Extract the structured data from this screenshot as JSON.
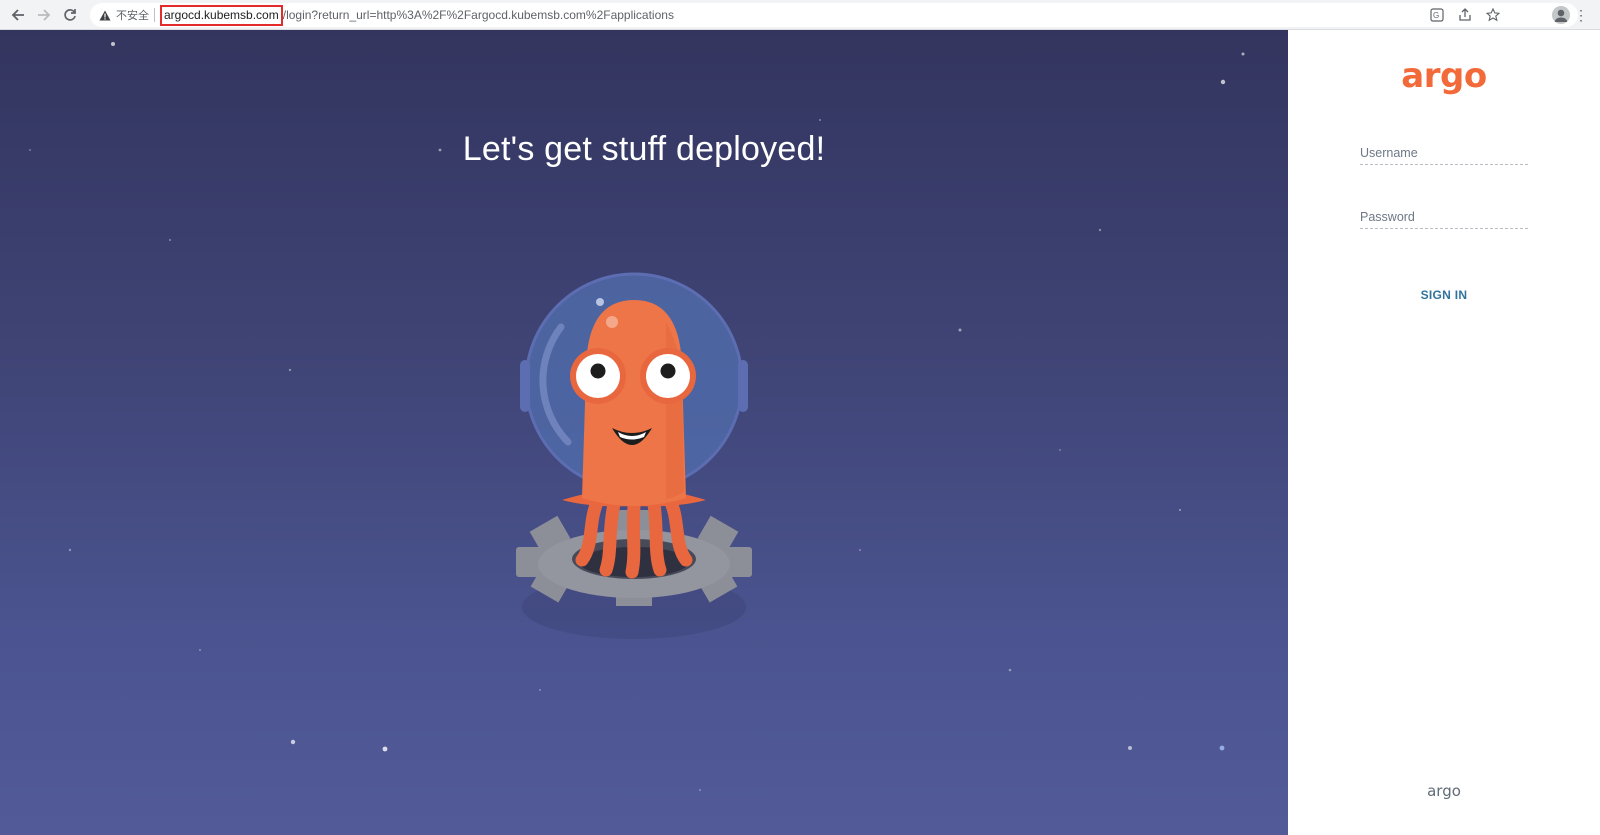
{
  "browser": {
    "security_text": "不安全",
    "url_host": "argocd.kubemsb.com",
    "url_path": "/login?return_url=http%3A%2F%2Fargocd.kubemsb.com%2Fapplications"
  },
  "hero": {
    "title": "Let's get stuff deployed!"
  },
  "login": {
    "logo": "argo",
    "username_placeholder": "Username",
    "password_placeholder": "Password",
    "sign_in_label": "SIGN IN",
    "footer_logo": "argo"
  },
  "colors": {
    "brand": "#f36a3a",
    "sign_in": "#31739d",
    "hero_top": "#33355f",
    "hero_bottom": "#525b98",
    "url_highlight": "#e32b2b"
  }
}
